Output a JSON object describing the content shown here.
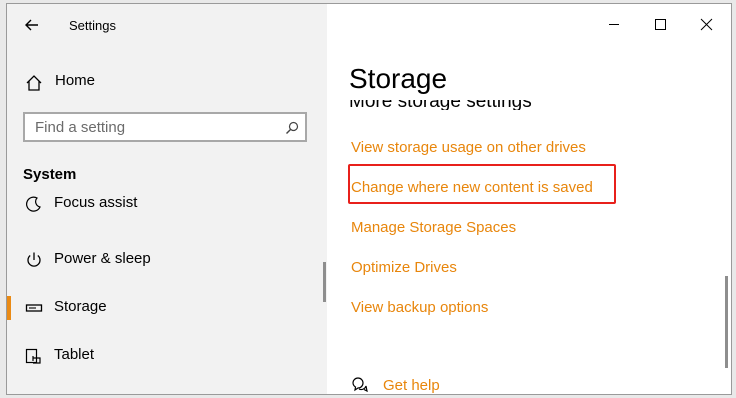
{
  "window": {
    "app_title": "Settings"
  },
  "sidebar": {
    "home_label": "Home",
    "search_placeholder": "Find a setting",
    "section_title": "System",
    "items": [
      {
        "label": "Focus assist",
        "icon": "moon-icon",
        "active": false
      },
      {
        "label": "Power & sleep",
        "icon": "power-icon",
        "active": false
      },
      {
        "label": "Storage",
        "icon": "drive-icon",
        "active": true
      },
      {
        "label": "Tablet",
        "icon": "tablet-icon",
        "active": false
      }
    ]
  },
  "main": {
    "page_title": "Storage",
    "sub_heading": "More storage settings",
    "links": [
      {
        "label": "View storage usage on other drives",
        "highlighted": false
      },
      {
        "label": "Change where new content is saved",
        "highlighted": true
      },
      {
        "label": "Manage Storage Spaces",
        "highlighted": false
      },
      {
        "label": "Optimize Drives",
        "highlighted": false
      },
      {
        "label": "View backup options",
        "highlighted": false
      }
    ],
    "help_label": "Get help"
  },
  "colors": {
    "accent": "#e8860c",
    "highlight_border": "#e8201b",
    "sidebar_bg": "#f2f2f2"
  }
}
